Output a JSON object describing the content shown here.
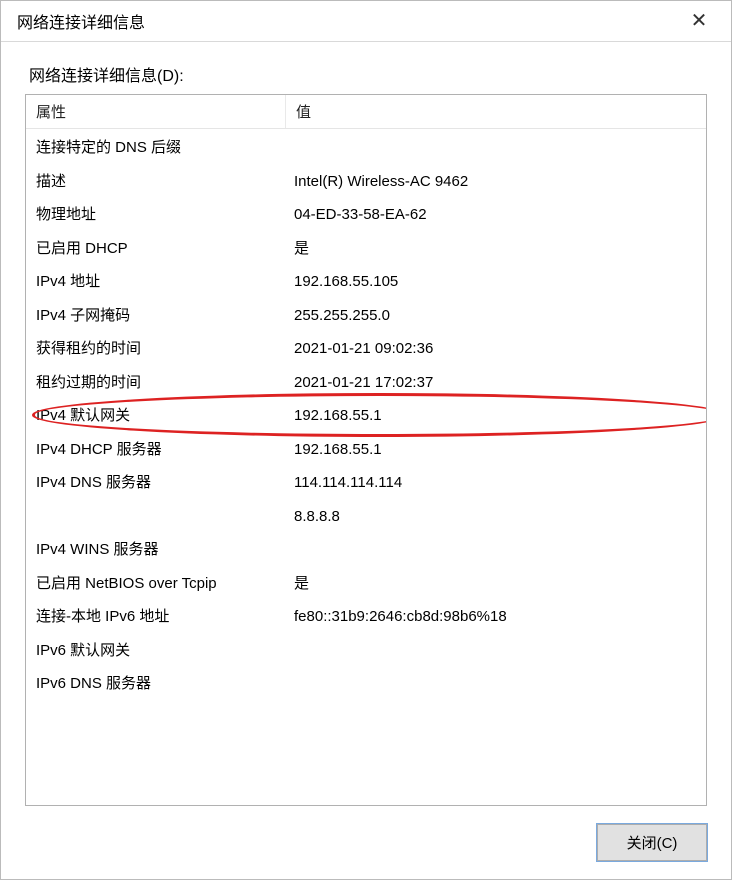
{
  "window": {
    "title": "网络连接详细信息",
    "section_label": "网络连接详细信息(D):"
  },
  "columns": {
    "property": "属性",
    "value": "值"
  },
  "rows": [
    {
      "prop": "连接特定的 DNS 后缀",
      "val": ""
    },
    {
      "prop": "描述",
      "val": "Intel(R) Wireless-AC 9462"
    },
    {
      "prop": "物理地址",
      "val": "04-ED-33-58-EA-62"
    },
    {
      "prop": "已启用 DHCP",
      "val": "是"
    },
    {
      "prop": "IPv4 地址",
      "val": "192.168.55.105"
    },
    {
      "prop": "IPv4 子网掩码",
      "val": "255.255.255.0"
    },
    {
      "prop": "获得租约的时间",
      "val": "2021-01-21 09:02:36"
    },
    {
      "prop": "租约过期的时间",
      "val": "2021-01-21 17:02:37"
    },
    {
      "prop": "IPv4 默认网关",
      "val": "192.168.55.1"
    },
    {
      "prop": "IPv4 DHCP 服务器",
      "val": "192.168.55.1"
    },
    {
      "prop": "IPv4 DNS 服务器",
      "val": "114.114.114.114"
    },
    {
      "prop": "",
      "val": "8.8.8.8"
    },
    {
      "prop": "IPv4 WINS 服务器",
      "val": ""
    },
    {
      "prop": "已启用 NetBIOS over Tcpip",
      "val": "是"
    },
    {
      "prop": "连接-本地 IPv6 地址",
      "val": "fe80::31b9:2646:cb8d:98b6%18"
    },
    {
      "prop": "IPv6 默认网关",
      "val": ""
    },
    {
      "prop": "IPv6 DNS 服务器",
      "val": ""
    }
  ],
  "buttons": {
    "close": "关闭(C)"
  },
  "highlight_row_index": 8
}
